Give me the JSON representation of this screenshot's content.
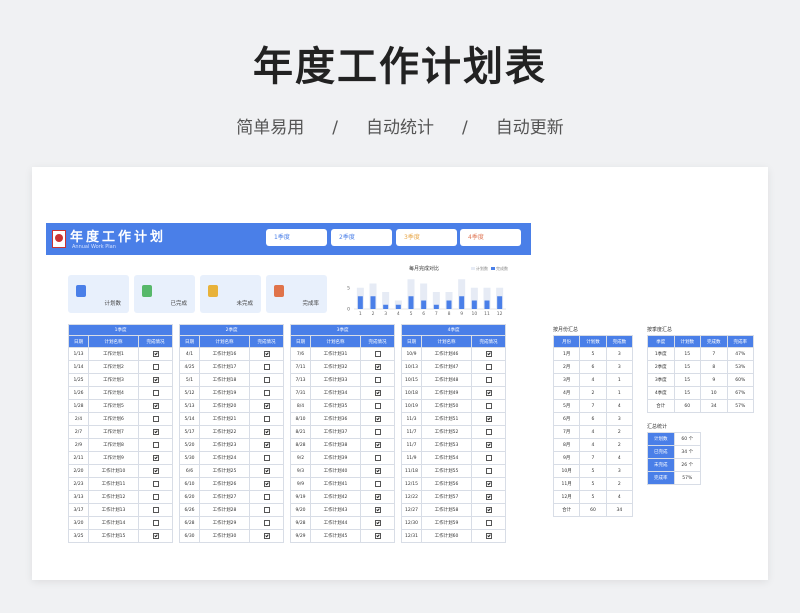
{
  "hero": {
    "title": "年度工作计划表",
    "subtitle_items": [
      "简单易用",
      "/",
      "自动统计",
      "/",
      "自动更新"
    ]
  },
  "header": {
    "title": "年度工作计划",
    "subtitle": "Annual Work Plan",
    "quarters": [
      "1季度",
      "2季度",
      "3季度",
      "4季度"
    ],
    "quarter_colors": [
      "#4a7fe8",
      "#4a7fe8",
      "#e8a84a",
      "#e07a5a"
    ]
  },
  "kpis": [
    {
      "label": "计划数",
      "color": "#4a7fe8"
    },
    {
      "label": "已完成",
      "color": "#57b86a"
    },
    {
      "label": "未完成",
      "color": "#e8b23a"
    },
    {
      "label": "完成率",
      "color": "#e0734a"
    }
  ],
  "chart_data": {
    "type": "bar",
    "title": "每月完成对比",
    "legend": [
      "计划数",
      "完成数"
    ],
    "categories": [
      "1",
      "2",
      "3",
      "4",
      "5",
      "6",
      "7",
      "8",
      "9",
      "10",
      "11",
      "12"
    ],
    "series": [
      {
        "name": "计划数",
        "values": [
          5,
          6,
          4,
          2,
          7,
          6,
          4,
          4,
          7,
          5,
          5,
          5
        ]
      },
      {
        "name": "完成数",
        "values": [
          3,
          3,
          1,
          1,
          3,
          2,
          1,
          2,
          3,
          2,
          2,
          3
        ]
      }
    ],
    "ylim": [
      0,
      8
    ],
    "yticks": [
      "0",
      "5"
    ],
    "colors": [
      "#e6ebf5",
      "#4a7fe8"
    ]
  },
  "plan_table": {
    "col_headers": [
      "日期",
      "计划名称",
      "完成情况"
    ],
    "quarters": [
      {
        "title": "1季度",
        "rows": [
          [
            "1/13",
            "工作计划1",
            true
          ],
          [
            "1/14",
            "工作计划2",
            false
          ],
          [
            "1/25",
            "工作计划3",
            true
          ],
          [
            "1/26",
            "工作计划4",
            false
          ],
          [
            "1/28",
            "工作计划5",
            true
          ],
          [
            "2/4",
            "工作计划6",
            false
          ],
          [
            "2/7",
            "工作计划7",
            true
          ],
          [
            "2/9",
            "工作计划8",
            false
          ],
          [
            "2/11",
            "工作计划9",
            true
          ],
          [
            "2/20",
            "工作计划10",
            true
          ],
          [
            "2/23",
            "工作计划11",
            false
          ],
          [
            "3/13",
            "工作计划12",
            false
          ],
          [
            "3/17",
            "工作计划13",
            false
          ],
          [
            "3/20",
            "工作计划14",
            false
          ],
          [
            "3/25",
            "工作计划15",
            true
          ]
        ]
      },
      {
        "title": "2季度",
        "rows": [
          [
            "4/1",
            "工作计划16",
            true
          ],
          [
            "4/25",
            "工作计划17",
            false
          ],
          [
            "5/1",
            "工作计划18",
            false
          ],
          [
            "5/12",
            "工作计划19",
            false
          ],
          [
            "5/13",
            "工作计划20",
            true
          ],
          [
            "5/14",
            "工作计划21",
            false
          ],
          [
            "5/17",
            "工作计划22",
            true
          ],
          [
            "5/20",
            "工作计划23",
            true
          ],
          [
            "5/30",
            "工作计划24",
            false
          ],
          [
            "6/6",
            "工作计划25",
            true
          ],
          [
            "6/10",
            "工作计划26",
            true
          ],
          [
            "6/20",
            "工作计划27",
            false
          ],
          [
            "6/26",
            "工作计划28",
            false
          ],
          [
            "6/28",
            "工作计划29",
            false
          ],
          [
            "6/30",
            "工作计划30",
            true
          ]
        ]
      },
      {
        "title": "3季度",
        "rows": [
          [
            "7/6",
            "工作计划31",
            false
          ],
          [
            "7/11",
            "工作计划32",
            true
          ],
          [
            "7/13",
            "工作计划33",
            false
          ],
          [
            "7/31",
            "工作计划34",
            true
          ],
          [
            "8/4",
            "工作计划35",
            false
          ],
          [
            "8/10",
            "工作计划36",
            true
          ],
          [
            "8/21",
            "工作计划37",
            false
          ],
          [
            "8/28",
            "工作计划38",
            true
          ],
          [
            "9/2",
            "工作计划39",
            false
          ],
          [
            "9/3",
            "工作计划40",
            true
          ],
          [
            "9/9",
            "工作计划41",
            false
          ],
          [
            "9/19",
            "工作计划42",
            true
          ],
          [
            "9/20",
            "工作计划43",
            true
          ],
          [
            "9/28",
            "工作计划44",
            true
          ],
          [
            "9/29",
            "工作计划45",
            true
          ]
        ]
      },
      {
        "title": "4季度",
        "rows": [
          [
            "10/9",
            "工作计划46",
            true
          ],
          [
            "10/13",
            "工作计划47",
            false
          ],
          [
            "10/15",
            "工作计划48",
            false
          ],
          [
            "10/18",
            "工作计划49",
            true
          ],
          [
            "10/19",
            "工作计划50",
            false
          ],
          [
            "11/3",
            "工作计划51",
            true
          ],
          [
            "11/7",
            "工作计划52",
            false
          ],
          [
            "11/7",
            "工作计划53",
            true
          ],
          [
            "11/9",
            "工作计划54",
            false
          ],
          [
            "11/18",
            "工作计划55",
            false
          ],
          [
            "12/15",
            "工作计划56",
            true
          ],
          [
            "12/22",
            "工作计划57",
            true
          ],
          [
            "12/27",
            "工作计划58",
            true
          ],
          [
            "12/30",
            "工作计划59",
            false
          ],
          [
            "12/31",
            "工作计划60",
            true
          ]
        ]
      }
    ]
  },
  "monthly_summary": {
    "title": "按月份汇总",
    "headers": [
      "月份",
      "计划数",
      "完成数"
    ],
    "rows": [
      [
        "1月",
        "5",
        "3"
      ],
      [
        "2月",
        "6",
        "3"
      ],
      [
        "3月",
        "4",
        "1"
      ],
      [
        "4月",
        "2",
        "1"
      ],
      [
        "5月",
        "7",
        "4"
      ],
      [
        "6月",
        "6",
        "3"
      ],
      [
        "7月",
        "4",
        "2"
      ],
      [
        "8月",
        "4",
        "2"
      ],
      [
        "9月",
        "7",
        "4"
      ],
      [
        "10月",
        "5",
        "3"
      ],
      [
        "11月",
        "5",
        "2"
      ],
      [
        "12月",
        "5",
        "4"
      ],
      [
        "合计",
        "60",
        "34"
      ]
    ]
  },
  "quarter_summary": {
    "title": "按季度汇总",
    "headers": [
      "季度",
      "计划数",
      "完成数",
      "完成率"
    ],
    "rows": [
      [
        "1季度",
        "15",
        "7",
        "47%"
      ],
      [
        "2季度",
        "15",
        "8",
        "53%"
      ],
      [
        "3季度",
        "15",
        "9",
        "60%"
      ],
      [
        "4季度",
        "15",
        "10",
        "67%"
      ],
      [
        "合计",
        "60",
        "34",
        "57%"
      ]
    ]
  },
  "total_summary": {
    "title": "汇总统计",
    "rows": [
      [
        "计划数",
        "60 个"
      ],
      [
        "已完成",
        "34 个"
      ],
      [
        "未完成",
        "26 个"
      ],
      [
        "完成率",
        "57%"
      ]
    ]
  }
}
